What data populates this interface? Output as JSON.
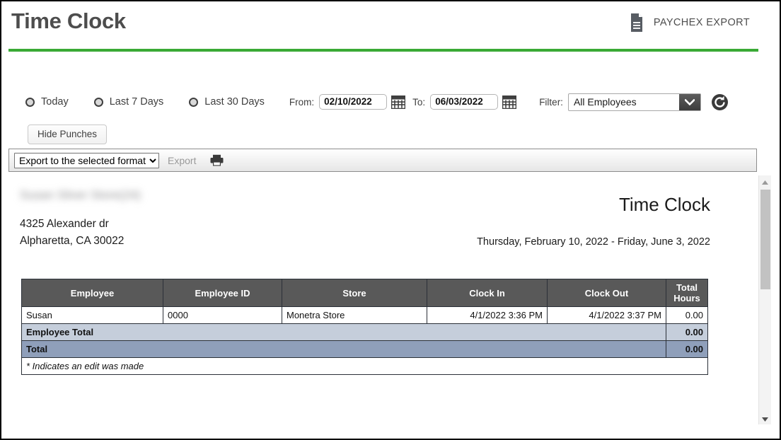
{
  "header": {
    "title": "Time Clock",
    "paychex_export_label": "PAYCHEX EXPORT",
    "paychex_export_icon": "document-export-icon",
    "accent_color": "#3aaa35"
  },
  "filters": {
    "range_options": [
      {
        "label": "Today",
        "selected": false
      },
      {
        "label": "Last 7 Days",
        "selected": false
      },
      {
        "label": "Last 30 Days",
        "selected": false
      }
    ],
    "from_label": "From:",
    "from_value": "02/10/2022",
    "from_calendar_icon": "calendar-icon",
    "to_label": "To:",
    "to_value": "06/03/2022",
    "to_calendar_icon": "calendar-icon",
    "filter_label": "Filter:",
    "filter_value": "All Employees",
    "filter_options": [
      "All Employees"
    ],
    "refresh_icon": "refresh-icon",
    "hide_punches_label": "Hide Punches"
  },
  "toolbar": {
    "export_format_value": "Export to the selected format",
    "export_format_options": [
      "Export to the selected format"
    ],
    "export_label": "Export",
    "print_icon": "printer-icon"
  },
  "report": {
    "store_name": "Susan Silver Store(24)",
    "address_line1": "4325 Alexander dr",
    "address_line2": "Alpharetta, CA 30022",
    "title": "Time Clock",
    "date_range": "Thursday, February 10, 2022 - Friday, June 3, 2022",
    "columns": [
      "Employee",
      "Employee ID",
      "Store",
      "Clock In",
      "Clock Out",
      "Total Hours"
    ],
    "rows": [
      {
        "employee": "Susan",
        "employee_id": "0000",
        "store": "Monetra Store",
        "clock_in": "4/1/2022 3:36 PM",
        "clock_out": "4/1/2022 3:37 PM",
        "total_hours": "0.00"
      }
    ],
    "employee_total_label": "Employee Total",
    "employee_total_value": "0.00",
    "grand_total_label": "Total",
    "grand_total_value": "0.00",
    "footnote": "* Indicates an edit was made"
  },
  "scrollbar": {
    "up_arrow_icon": "triangle-up-icon",
    "down_arrow_icon": "triangle-down-icon"
  }
}
